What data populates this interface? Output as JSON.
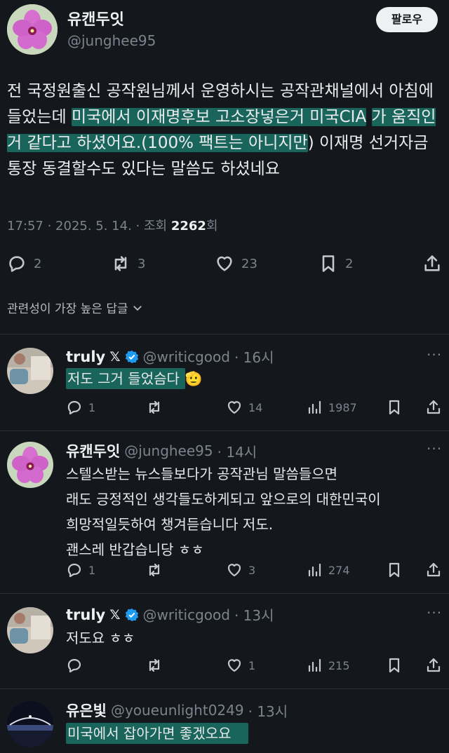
{
  "post": {
    "author_name": "유캔두잇",
    "author_handle": "@junghee95",
    "follow_label": "팔로우",
    "text_part1": "전 국정원출신 공작원님께서 운영하시는 공작관채널에서 아침에 들었는데 ",
    "text_highlight1": "미국에서 이재명후보 고소장넣은거 미국CIA",
    "text_highlight2": "가 움직인거 같다고 하셨어요.(100% 팩트는 아니지만",
    "text_part2": ") 이재명 선거자금 통장 동결할수도 있다는 말씀도 하셨네요",
    "time": "17:57 · 2025. 5. 14. · 조회 ",
    "views": "2262",
    "views_suffix": "회",
    "replies": "2",
    "reposts": "3",
    "likes": "23",
    "bookmarks": "2"
  },
  "sort_label": "관련성이 가장 높은 답글",
  "replies": [
    {
      "name": "truly",
      "x_badge": "𝕏",
      "handle": "@writicgood",
      "time": "· 16시",
      "text": "저도 그거 들었슴다",
      "emoji": "🫡",
      "replies": "1",
      "reposts": "",
      "likes": "14",
      "views": "1987"
    },
    {
      "name": "유캔두잇",
      "handle": "@junghee95",
      "time": "· 14시",
      "line1": "스텔스받는 뉴스들보다가 공작관님 말씀들으면",
      "line2": "래도 긍정적인 생각들도하게되고 앞으로의 대한민국이",
      "line3": "희망적일듯하여 챙겨듣습니다 저도.",
      "line4": "괜스레 반갑습니당 ㅎㅎ",
      "replies": "1",
      "reposts": "",
      "likes": "3",
      "views": "274"
    },
    {
      "name": "truly",
      "x_badge": "𝕏",
      "handle": "@writicgood",
      "time": "· 13시",
      "text": "저도요 ㅎㅎ",
      "replies": "",
      "reposts": "",
      "likes": "1",
      "views": "215"
    },
    {
      "name": "유은빛",
      "handle": "@youeunlight0249",
      "time": "· 13시",
      "text": "미국에서 잡아가면 좋겠오요"
    }
  ],
  "more_label": "···",
  "colors": {
    "background": "#14181d",
    "highlight": "#1fa68e",
    "verified": "#1d9bf0"
  }
}
